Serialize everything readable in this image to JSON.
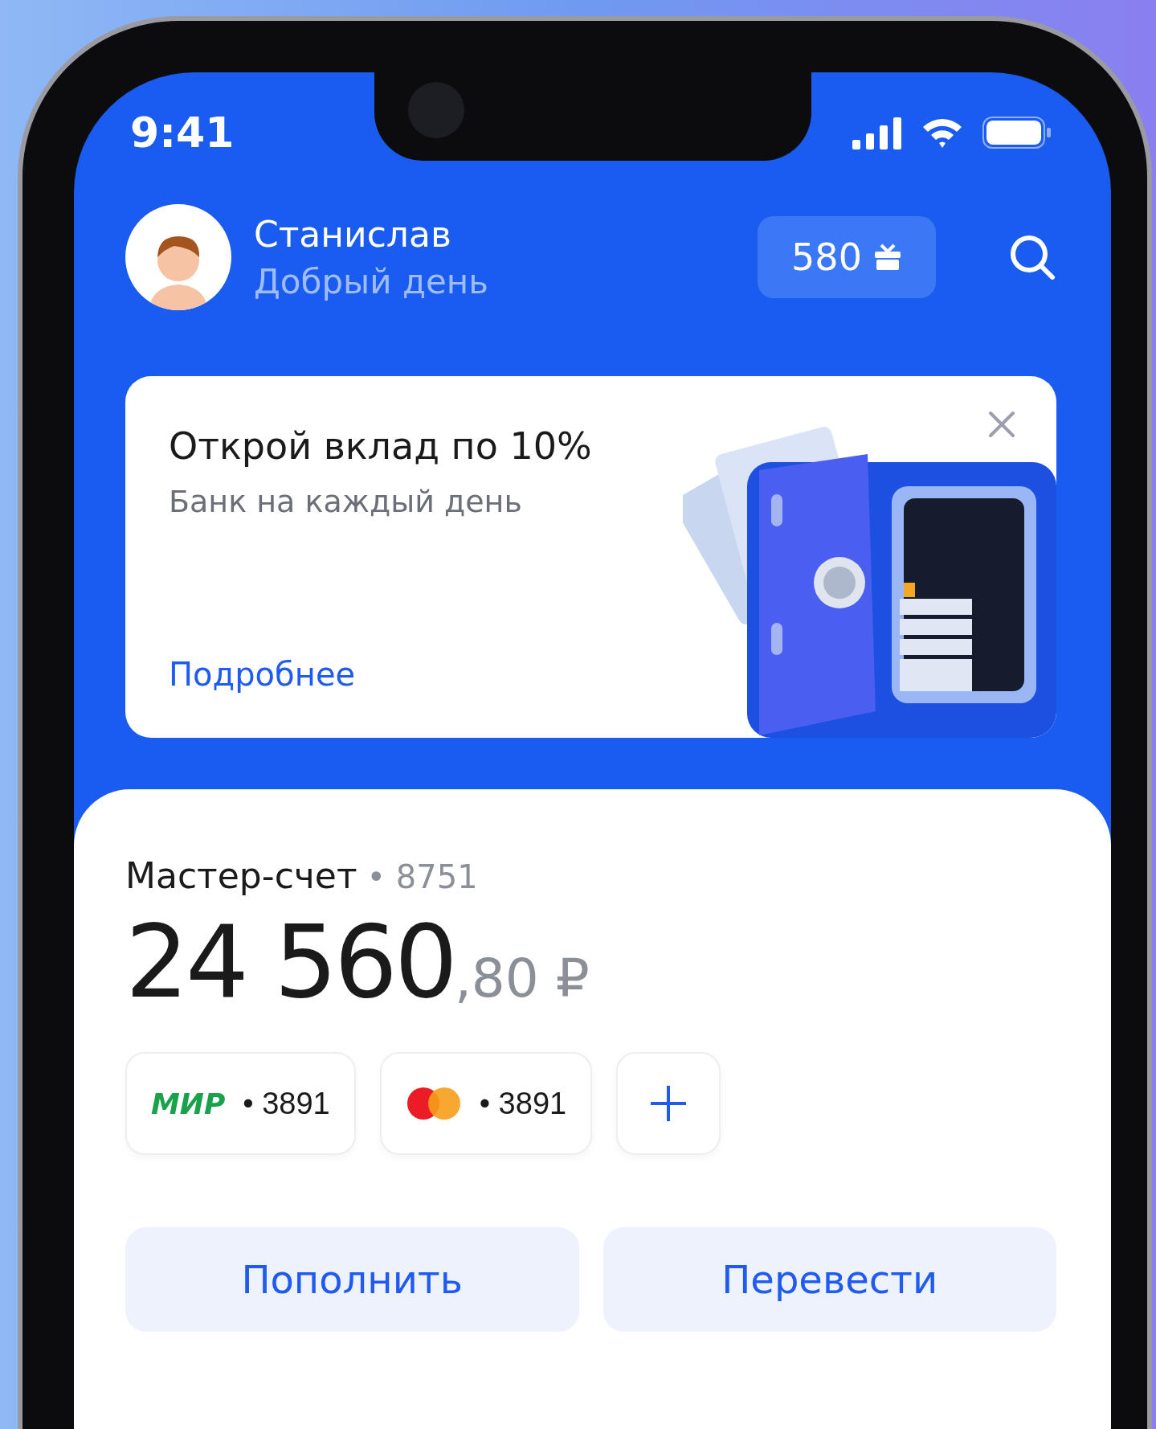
{
  "status_bar": {
    "time": "9:41"
  },
  "header": {
    "name": "Станислав",
    "greeting": "Добрый день",
    "points": "580"
  },
  "promo": {
    "title": "Открой вклад по 10%",
    "subtitle": "Банк на каждый день",
    "link": "Подробнее"
  },
  "account": {
    "name": "Мастер-счет",
    "number": "• 8751",
    "balance_main": "24 560",
    "balance_fraction": ",80 ₽"
  },
  "cards": [
    {
      "kind": "mir",
      "logo_text": "МИР",
      "number": "• 3891"
    },
    {
      "kind": "mastercard",
      "number": "• 3891"
    }
  ],
  "actions": [
    "Пополнить",
    "Перевести"
  ]
}
